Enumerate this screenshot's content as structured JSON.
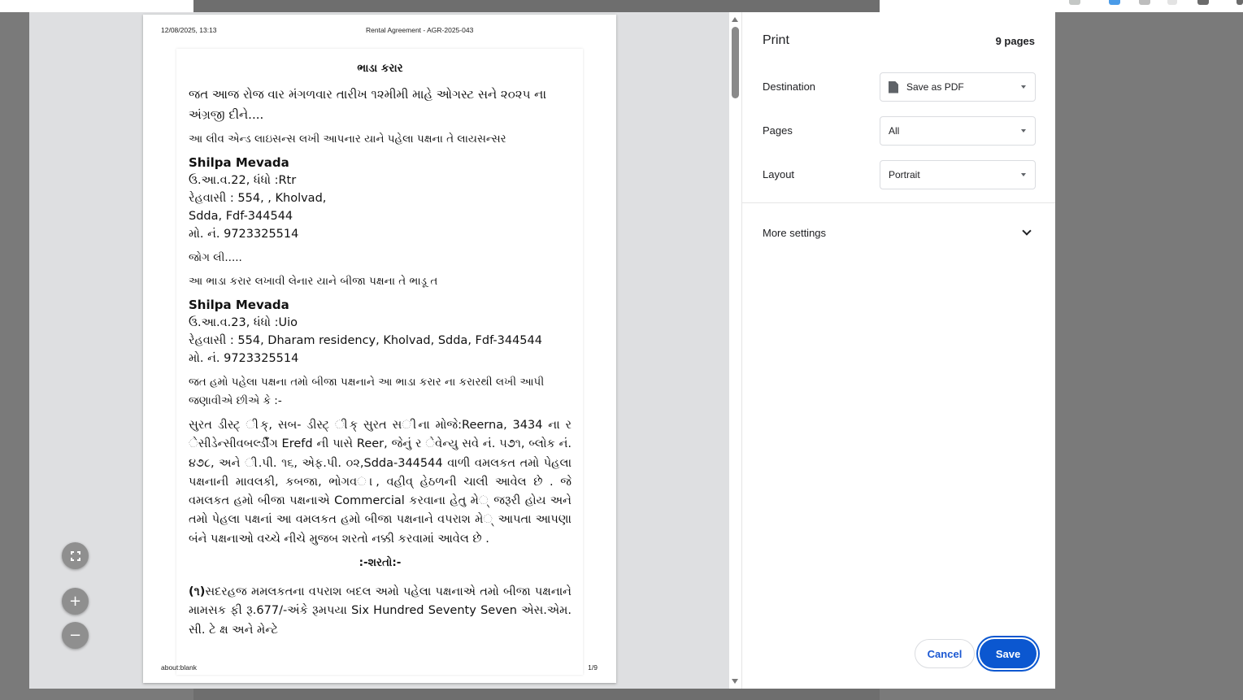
{
  "browser": {
    "strip_icons": [
      {
        "name": "star-icon",
        "color": "#9aa0a6"
      },
      {
        "name": "extension-blue-icon",
        "color": "#4a9be8"
      },
      {
        "name": "extension-gray-icon",
        "color": "#bdbdbd"
      },
      {
        "name": "extension-gray-2-icon",
        "color": "#e0e0e0"
      },
      {
        "name": "profile-icon",
        "color": "#5f6368"
      }
    ]
  },
  "preview": {
    "header_datetime": "12/08/2025, 13:13",
    "header_title": "Rental Agreement - AGR-2025-043",
    "footer_url": "about:blank",
    "footer_page": "1/9",
    "document": {
      "title": "ભાડા કરાર",
      "intro": "જત આજ રોજ વાર મંગળવાર તારીખ ૧૨મીમી માહે ઓગસ્ટ સને ૨૦૨૫ ના અંગ્રજી દીને....",
      "licensor_intro": "આ લીવ એન્ડ લાઇસન્સ લખી આપનાર યાને પહેલા પક્ષના તે લાયસન્સર",
      "party1": {
        "name": "Shilpa Mevada",
        "age_line": "ઉ.આ.વ.22, ધંધો :Rtr",
        "address1": "રેહવાસી : 554, , Kholvad,",
        "address2": "Sdda, Fdf-344544",
        "phone": "મો. નં. 9723325514"
      },
      "jog_li": "જોગ લી.....",
      "tenant_intro": "આ ભાડા કરાર લખાવી લેનાર યાને બીજા પક્ષના તે ભાડૂ ત",
      "party2": {
        "name": "Shilpa Mevada",
        "age_line": "ઉ.આ.વ.23, ધંધો :Uio",
        "address1": "રેહવાસી : 554, Dharam residency, Kholvad, Sdda, Fdf-344544",
        "phone": "મો. નં. 9723325514"
      },
      "declaration": "જત હમો પહેલા પક્ષના તમો બીજા પક્ષનાને આ ભાડા કરાર ના કરારથી લખી આપી જણાવીએ છીએ કે :-",
      "property_desc": "સુરત ડીસ્ટ્ ◌ીક્, સબ- ડીસ્ટ્ ◌ીક્ સુરત સ◌ીના મોજે:Reerna, 3434 ના ર ◌ેસીડેન્સીવબર્લ્ડીંગ Erefd ની પાસે Reer, જેનું ર ◌ેવેન્યુ સવે નં. ૫૭૧, બ્લોક નં. ૪૭૮, અને ◌ી.પી. ૧૬, એફ.પી. ૦૨,Sdda-344544 વાળી વમલકત તમો પેહલા પક્ષનાની માવલકી, કબજા, ભોગવ◌ા, વહીવ્ હેઠળની ચાલી આવેલ છે . જે વમલકત હમો બીજા પક્ષનાએ Commercial કરવાના હેતુ મે◌્ જરૂરી હોય અને તમો પેહલા પક્ષનાં આ વમલકત હમો બીજા પક્ષનાને વપરાશ મે◌્ આપતા આપણા બંને પક્ષનાઓ વચ્ચે નીચે મુજબ શરતો નક્કી કરવામાં આવેલ છે .",
      "terms_heading": ":-શરતો:-",
      "clause1_num": "(૧)",
      "clause1": "સદરહજ મમલકતના વપરાશ બદલ અમો પહેલા પક્ષનાએ તમો બીજા પક્ષનાને મામસક ફી રૂ.677/-અંકે રૂમપયા Six Hundred Seventy Seven એસ.એમ. સી. ટે ક્ષ અને મેન્ટે"
    },
    "zoom_in_symbol": "+",
    "zoom_out_symbol": "−"
  },
  "print": {
    "title": "Print",
    "page_count": "9 pages",
    "destination_label": "Destination",
    "destination_value": "Save as PDF",
    "pages_label": "Pages",
    "pages_value": "All",
    "layout_label": "Layout",
    "layout_value": "Portrait",
    "more_settings_label": "More settings",
    "cancel_label": "Cancel",
    "save_label": "Save",
    "accent_color": "#0b57d0"
  }
}
